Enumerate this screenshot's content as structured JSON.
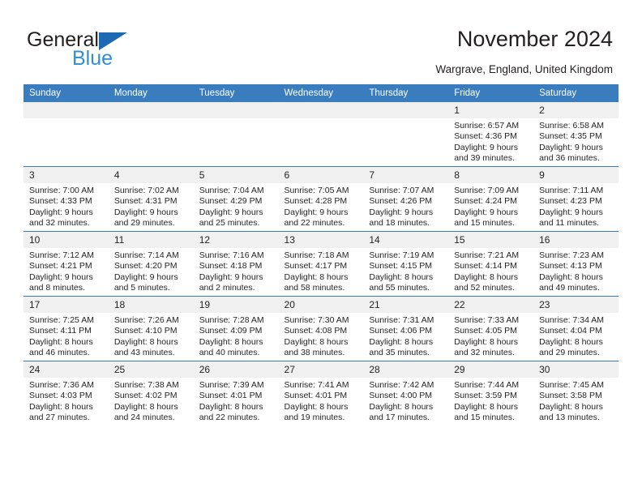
{
  "brand": {
    "name_top": "General",
    "name_bottom": "Blue",
    "accent_color": "#1b69b2",
    "accent_color_light": "#2c8fd8"
  },
  "header": {
    "title": "November 2024",
    "subtitle": "Wargrave, England, United Kingdom"
  },
  "colors": {
    "header_row_bg": "#3a7dbf",
    "day_number_bg": "#f0f0f0",
    "text": "#231f20"
  },
  "calendar": {
    "weekday_headers": [
      "Sunday",
      "Monday",
      "Tuesday",
      "Wednesday",
      "Thursday",
      "Friday",
      "Saturday"
    ],
    "weeks": [
      [
        {
          "day": "",
          "empty": true,
          "lines": []
        },
        {
          "day": "",
          "empty": true,
          "lines": []
        },
        {
          "day": "",
          "empty": true,
          "lines": []
        },
        {
          "day": "",
          "empty": true,
          "lines": []
        },
        {
          "day": "",
          "empty": true,
          "lines": []
        },
        {
          "day": "1",
          "lines": [
            "Sunrise: 6:57 AM",
            "Sunset: 4:36 PM",
            "Daylight: 9 hours",
            "and 39 minutes."
          ]
        },
        {
          "day": "2",
          "lines": [
            "Sunrise: 6:58 AM",
            "Sunset: 4:35 PM",
            "Daylight: 9 hours",
            "and 36 minutes."
          ]
        }
      ],
      [
        {
          "day": "3",
          "lines": [
            "Sunrise: 7:00 AM",
            "Sunset: 4:33 PM",
            "Daylight: 9 hours",
            "and 32 minutes."
          ]
        },
        {
          "day": "4",
          "lines": [
            "Sunrise: 7:02 AM",
            "Sunset: 4:31 PM",
            "Daylight: 9 hours",
            "and 29 minutes."
          ]
        },
        {
          "day": "5",
          "lines": [
            "Sunrise: 7:04 AM",
            "Sunset: 4:29 PM",
            "Daylight: 9 hours",
            "and 25 minutes."
          ]
        },
        {
          "day": "6",
          "lines": [
            "Sunrise: 7:05 AM",
            "Sunset: 4:28 PM",
            "Daylight: 9 hours",
            "and 22 minutes."
          ]
        },
        {
          "day": "7",
          "lines": [
            "Sunrise: 7:07 AM",
            "Sunset: 4:26 PM",
            "Daylight: 9 hours",
            "and 18 minutes."
          ]
        },
        {
          "day": "8",
          "lines": [
            "Sunrise: 7:09 AM",
            "Sunset: 4:24 PM",
            "Daylight: 9 hours",
            "and 15 minutes."
          ]
        },
        {
          "day": "9",
          "lines": [
            "Sunrise: 7:11 AM",
            "Sunset: 4:23 PM",
            "Daylight: 9 hours",
            "and 11 minutes."
          ]
        }
      ],
      [
        {
          "day": "10",
          "lines": [
            "Sunrise: 7:12 AM",
            "Sunset: 4:21 PM",
            "Daylight: 9 hours",
            "and 8 minutes."
          ]
        },
        {
          "day": "11",
          "lines": [
            "Sunrise: 7:14 AM",
            "Sunset: 4:20 PM",
            "Daylight: 9 hours",
            "and 5 minutes."
          ]
        },
        {
          "day": "12",
          "lines": [
            "Sunrise: 7:16 AM",
            "Sunset: 4:18 PM",
            "Daylight: 9 hours",
            "and 2 minutes."
          ]
        },
        {
          "day": "13",
          "lines": [
            "Sunrise: 7:18 AM",
            "Sunset: 4:17 PM",
            "Daylight: 8 hours",
            "and 58 minutes."
          ]
        },
        {
          "day": "14",
          "lines": [
            "Sunrise: 7:19 AM",
            "Sunset: 4:15 PM",
            "Daylight: 8 hours",
            "and 55 minutes."
          ]
        },
        {
          "day": "15",
          "lines": [
            "Sunrise: 7:21 AM",
            "Sunset: 4:14 PM",
            "Daylight: 8 hours",
            "and 52 minutes."
          ]
        },
        {
          "day": "16",
          "lines": [
            "Sunrise: 7:23 AM",
            "Sunset: 4:13 PM",
            "Daylight: 8 hours",
            "and 49 minutes."
          ]
        }
      ],
      [
        {
          "day": "17",
          "lines": [
            "Sunrise: 7:25 AM",
            "Sunset: 4:11 PM",
            "Daylight: 8 hours",
            "and 46 minutes."
          ]
        },
        {
          "day": "18",
          "lines": [
            "Sunrise: 7:26 AM",
            "Sunset: 4:10 PM",
            "Daylight: 8 hours",
            "and 43 minutes."
          ]
        },
        {
          "day": "19",
          "lines": [
            "Sunrise: 7:28 AM",
            "Sunset: 4:09 PM",
            "Daylight: 8 hours",
            "and 40 minutes."
          ]
        },
        {
          "day": "20",
          "lines": [
            "Sunrise: 7:30 AM",
            "Sunset: 4:08 PM",
            "Daylight: 8 hours",
            "and 38 minutes."
          ]
        },
        {
          "day": "21",
          "lines": [
            "Sunrise: 7:31 AM",
            "Sunset: 4:06 PM",
            "Daylight: 8 hours",
            "and 35 minutes."
          ]
        },
        {
          "day": "22",
          "lines": [
            "Sunrise: 7:33 AM",
            "Sunset: 4:05 PM",
            "Daylight: 8 hours",
            "and 32 minutes."
          ]
        },
        {
          "day": "23",
          "lines": [
            "Sunrise: 7:34 AM",
            "Sunset: 4:04 PM",
            "Daylight: 8 hours",
            "and 29 minutes."
          ]
        }
      ],
      [
        {
          "day": "24",
          "lines": [
            "Sunrise: 7:36 AM",
            "Sunset: 4:03 PM",
            "Daylight: 8 hours",
            "and 27 minutes."
          ]
        },
        {
          "day": "25",
          "lines": [
            "Sunrise: 7:38 AM",
            "Sunset: 4:02 PM",
            "Daylight: 8 hours",
            "and 24 minutes."
          ]
        },
        {
          "day": "26",
          "lines": [
            "Sunrise: 7:39 AM",
            "Sunset: 4:01 PM",
            "Daylight: 8 hours",
            "and 22 minutes."
          ]
        },
        {
          "day": "27",
          "lines": [
            "Sunrise: 7:41 AM",
            "Sunset: 4:01 PM",
            "Daylight: 8 hours",
            "and 19 minutes."
          ]
        },
        {
          "day": "28",
          "lines": [
            "Sunrise: 7:42 AM",
            "Sunset: 4:00 PM",
            "Daylight: 8 hours",
            "and 17 minutes."
          ]
        },
        {
          "day": "29",
          "lines": [
            "Sunrise: 7:44 AM",
            "Sunset: 3:59 PM",
            "Daylight: 8 hours",
            "and 15 minutes."
          ]
        },
        {
          "day": "30",
          "lines": [
            "Sunrise: 7:45 AM",
            "Sunset: 3:58 PM",
            "Daylight: 8 hours",
            "and 13 minutes."
          ]
        }
      ]
    ]
  }
}
